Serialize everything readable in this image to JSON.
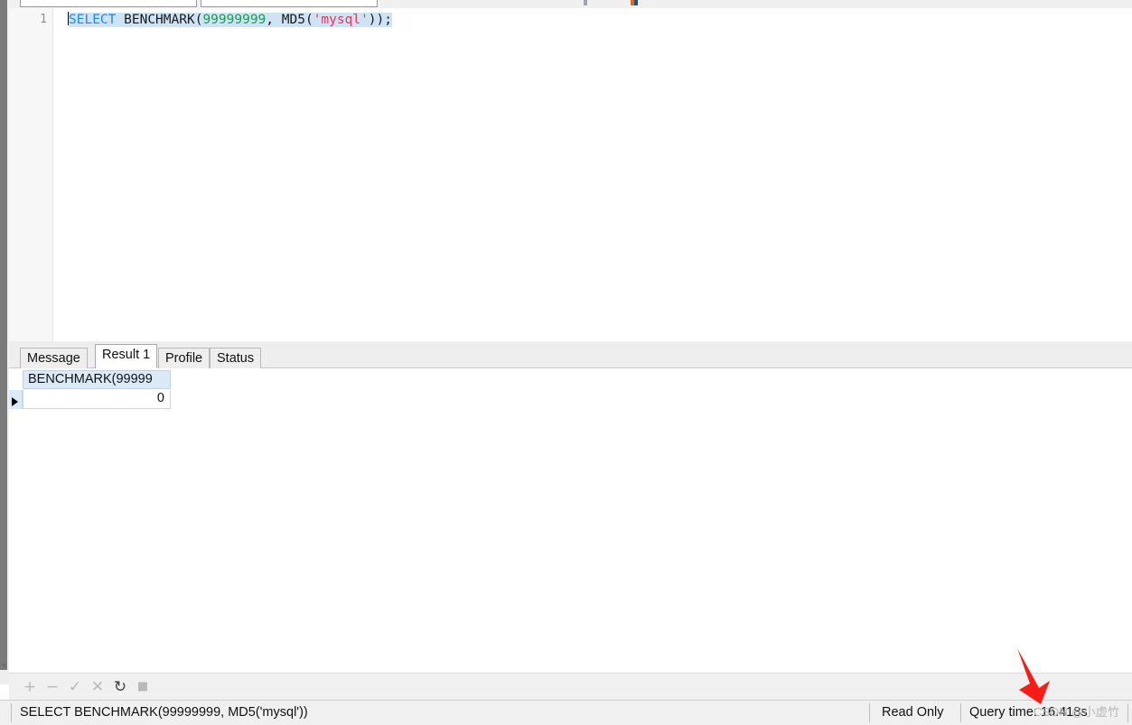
{
  "window": {
    "left_edge_scroll_icon": "scroll-down-arrow"
  },
  "toolbar": {
    "combo_one_value": "",
    "combo_two_value": "",
    "icon_fragments": [
      "toolbar-icon-fragment-a",
      "toolbar-icon-fragment-b",
      "toolbar-icon-fragment-c"
    ]
  },
  "editor": {
    "line_number": "1",
    "full_text": "SELECT BENCHMARK(99999999, MD5('mysql'));",
    "tokens": {
      "keyword": "SELECT",
      "space1": " ",
      "function": "BENCHMARK",
      "paren_open": "(",
      "number": "99999999",
      "comma": ", ",
      "md5": "MD5",
      "paren_open2": "(",
      "string": "'mysql'",
      "paren_close": "))",
      "semicolon": ";"
    },
    "colors": {
      "keyword": "#2288dd",
      "number": "#17a04a",
      "string": "#ee3355",
      "plain": "#1a1a1a",
      "selection": "#cfe3f7"
    }
  },
  "results": {
    "tabs": [
      {
        "label": "Message",
        "active": false
      },
      {
        "label": "Result 1",
        "active": true
      },
      {
        "label": "Profile",
        "active": false
      },
      {
        "label": "Status",
        "active": false
      }
    ],
    "grid": {
      "columns": [
        "BENCHMARK(99999"
      ],
      "rows": [
        {
          "selected": true,
          "values": [
            "0"
          ]
        }
      ]
    }
  },
  "grid_toolbar": {
    "buttons": [
      {
        "name": "add-row-button",
        "glyph": "+",
        "enabled": false
      },
      {
        "name": "remove-row-button",
        "glyph": "−",
        "enabled": false
      },
      {
        "name": "apply-changes-button",
        "glyph": "✓",
        "enabled": false
      },
      {
        "name": "discard-changes-button",
        "glyph": "✕",
        "enabled": false
      },
      {
        "name": "refresh-button",
        "glyph": "↻",
        "enabled": true
      },
      {
        "name": "stop-button",
        "glyph": "■",
        "enabled": false
      }
    ]
  },
  "statusbar": {
    "query_text": "SELECT BENCHMARK(99999999, MD5('mysql'))",
    "read_only_label": "Read Only",
    "query_time_label": "Query time: 16.418s"
  },
  "annotation": {
    "arrow_color": "#f71d16",
    "arrow_name": "red-annotation-arrow"
  },
  "watermark": {
    "text": "CSDN @小虚竹"
  }
}
